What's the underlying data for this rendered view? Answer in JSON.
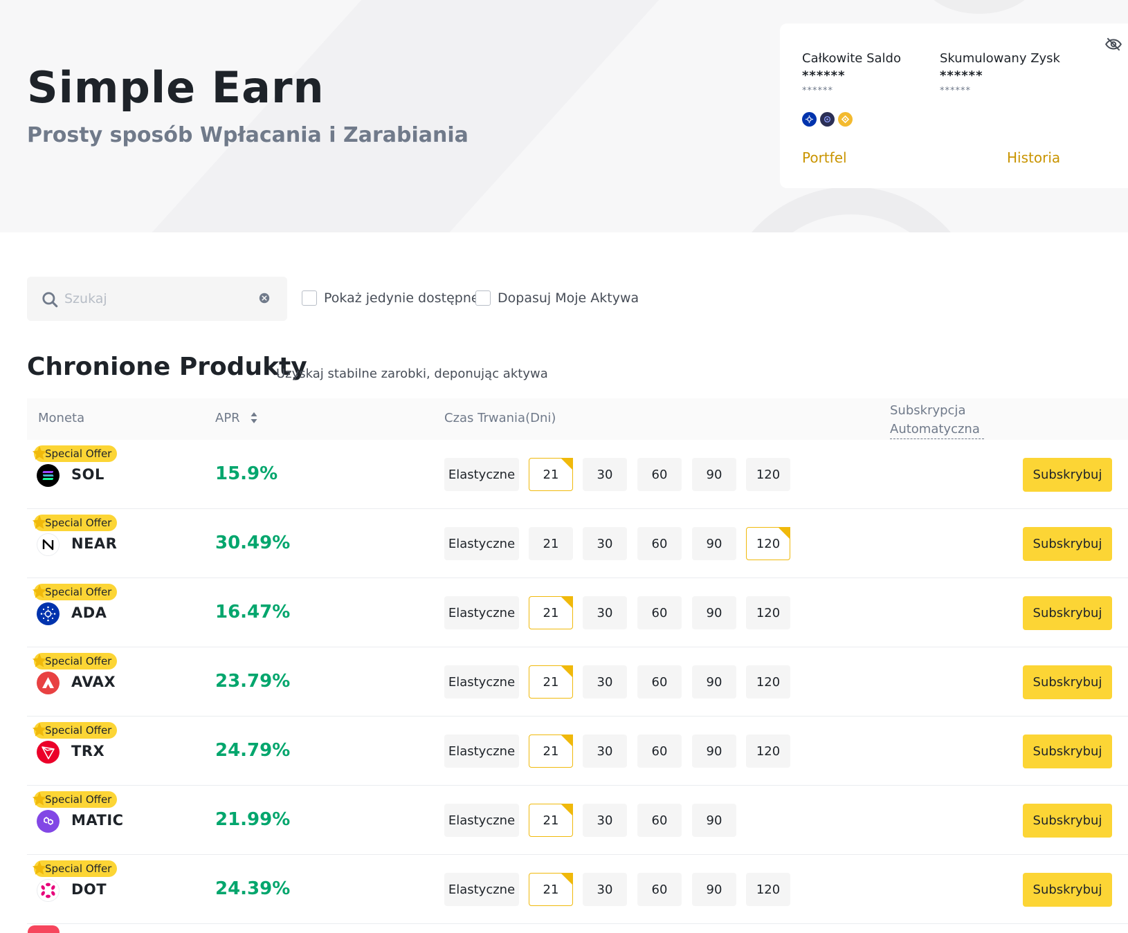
{
  "hero": {
    "title": "Simple Earn",
    "subtitle": "Prosty sposób Wpłacania i Zarabiania"
  },
  "balance": {
    "total_label": "Całkowite Saldo",
    "total_value": "******",
    "total_value_small": "******",
    "profit_label": "Skumulowany Zysk",
    "profit_value": "******",
    "profit_value_small": "******",
    "coin_icons": [
      "ada-icon",
      "near-icon",
      "bnb-icon"
    ],
    "wallet_link": "Portfel",
    "history_link": "Historia"
  },
  "filters": {
    "search_placeholder": "Szukaj",
    "only_available_label": "Pokaż jedynie dostępne",
    "match_assets_label": "Dopasuj Moje Aktywa"
  },
  "section": {
    "title": "Chronione Produkty",
    "subtitle": "Uzyskaj stabilne zarobki, deponując aktywa"
  },
  "table": {
    "headers": {
      "coin": "Moneta",
      "apr": "APR",
      "duration": "Czas Trwania(Dni)",
      "auto_line1": "Subskrypcja",
      "auto_line2": "Automatyczna"
    },
    "offer_label": "Special Offer",
    "flexible_label": "Elastyczne",
    "subscribe_label": "Subskrybuj",
    "rows": [
      {
        "coin": "SOL",
        "apr": "15.9%",
        "durations": [
          "21",
          "30",
          "60",
          "90",
          "120"
        ],
        "selected": "21",
        "color": "#000000"
      },
      {
        "coin": "NEAR",
        "apr": "30.49%",
        "durations": [
          "21",
          "30",
          "60",
          "90",
          "120"
        ],
        "selected": "120",
        "color": "#ffffff"
      },
      {
        "coin": "ADA",
        "apr": "16.47%",
        "durations": [
          "21",
          "30",
          "60",
          "90",
          "120"
        ],
        "selected": "21",
        "color": "#0033ad"
      },
      {
        "coin": "AVAX",
        "apr": "23.79%",
        "durations": [
          "21",
          "30",
          "60",
          "90",
          "120"
        ],
        "selected": "21",
        "color": "#e84142"
      },
      {
        "coin": "TRX",
        "apr": "24.79%",
        "durations": [
          "21",
          "30",
          "60",
          "90",
          "120"
        ],
        "selected": "21",
        "color": "#eb0029"
      },
      {
        "coin": "MATIC",
        "apr": "21.99%",
        "durations": [
          "21",
          "30",
          "60",
          "90"
        ],
        "selected": "21",
        "color": "#8247e5"
      },
      {
        "coin": "DOT",
        "apr": "24.39%",
        "durations": [
          "21",
          "30",
          "60",
          "90",
          "120"
        ],
        "selected": "21",
        "color": "#e6007a"
      }
    ]
  },
  "colors": {
    "accent": "#fcd535",
    "accent_border": "#f0b90b",
    "apr_green": "#03a66d",
    "link_gold": "#c99400"
  }
}
